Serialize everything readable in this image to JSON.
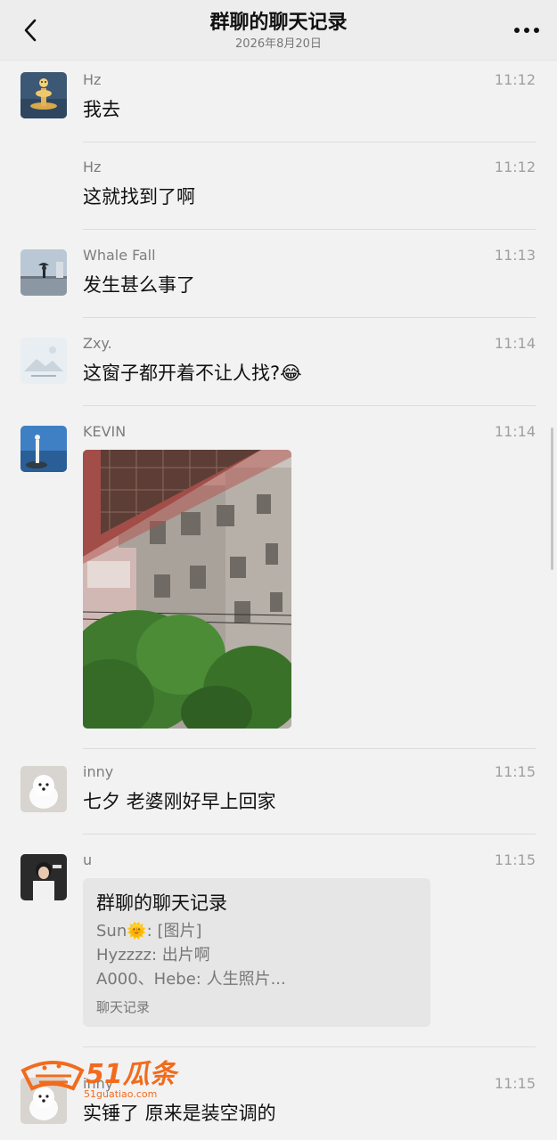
{
  "header": {
    "title": "群聊的聊天记录",
    "date": "2026年8月20日"
  },
  "messages": [
    {
      "name": "Hz",
      "time": "11:12",
      "text": "我去"
    },
    {
      "name": "Hz",
      "time": "11:12",
      "text": "这就找到了啊"
    },
    {
      "name": "Whale Fall",
      "time": "11:13",
      "text": "发生甚么事了"
    },
    {
      "name": "Zxy.",
      "time": "11:14",
      "text": "这窗子都开着不让人找?😂"
    },
    {
      "name": "KEVIN",
      "time": "11:14"
    },
    {
      "name": "inny",
      "time": "11:15",
      "text": "七夕 老婆刚好早上回家"
    },
    {
      "name": "u",
      "time": "11:15"
    },
    {
      "name": "inny",
      "time": "11:15",
      "text": "实锤了 原来是装空调的"
    }
  ],
  "record_card": {
    "title": "群聊的聊天记录",
    "lines": [
      "Sun🌞: [图片]",
      "Hyzzzz: 出片啊",
      "A000、Hebe: 人生照片..."
    ],
    "footer": "聊天记录"
  },
  "watermark": {
    "brand": "51瓜条",
    "url": "51guatiao.com"
  },
  "colors": {
    "background": "#f2f2f2",
    "header": "#ededed",
    "watermark": "#f26b1d"
  }
}
